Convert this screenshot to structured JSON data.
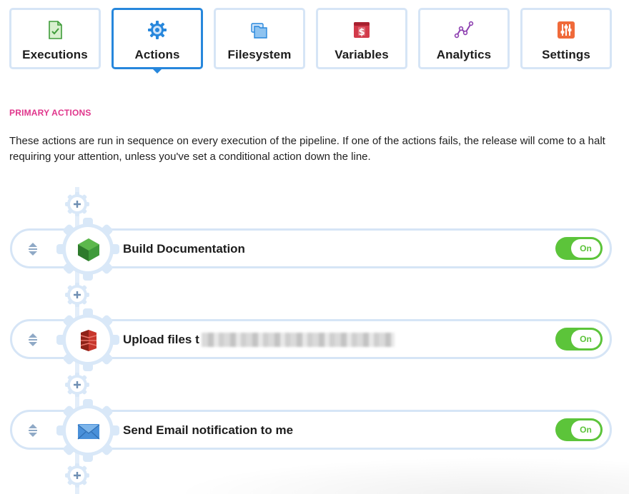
{
  "tabs": [
    {
      "label": "Executions",
      "icon": "document-check-icon",
      "active": false
    },
    {
      "label": "Actions",
      "icon": "gear-icon",
      "active": true
    },
    {
      "label": "Filesystem",
      "icon": "folder-icon",
      "active": false
    },
    {
      "label": "Variables",
      "icon": "dollar-card-icon",
      "active": false
    },
    {
      "label": "Analytics",
      "icon": "line-chart-icon",
      "active": false
    },
    {
      "label": "Settings",
      "icon": "sliders-icon",
      "active": false
    }
  ],
  "section": {
    "title": "PRIMARY ACTIONS",
    "description": "These actions are run in sequence on every execution of the pipeline. If one of the actions fails, the release will come to a halt requiring your attention, unless you've set a conditional action down the line."
  },
  "actions": [
    {
      "label": "Build Documentation",
      "icon": "nodejs-hexagon-icon",
      "toggle": "On",
      "enabled": true
    },
    {
      "label": "Upload files t",
      "icon": "amazon-s3-icon",
      "toggle": "On",
      "enabled": true,
      "redacted": true
    },
    {
      "label": "Send Email notification to me",
      "icon": "email-envelope-icon",
      "toggle": "On",
      "enabled": true
    }
  ],
  "colors": {
    "accent": "#2787dc",
    "section_title": "#e0368c",
    "toggle_on": "#5cc43a",
    "border": "#d6e5f6"
  }
}
